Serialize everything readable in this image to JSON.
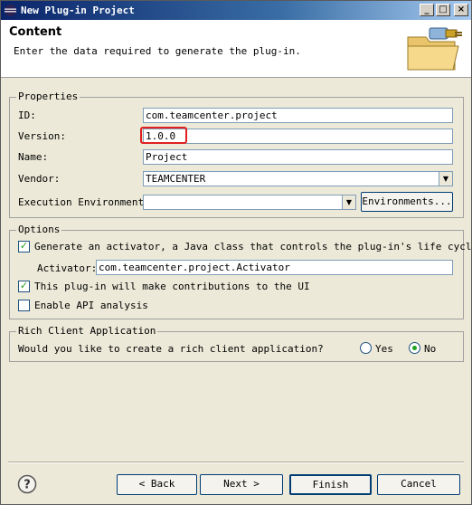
{
  "window": {
    "title": "New Plug-in Project",
    "minimize": "_",
    "maximize": "□",
    "close": "×"
  },
  "header": {
    "title": "Content",
    "description": "Enter the data required to generate the plug-in."
  },
  "properties": {
    "group_label": "Properties",
    "id_label": "ID:",
    "id_value": "com.teamcenter.project",
    "version_label": "Version:",
    "version_value": "1.0.0",
    "name_label": "Name:",
    "name_value": "Project",
    "vendor_label": "Vendor:",
    "vendor_value": "TEAMCENTER",
    "exec_env_label": "Execution Environment:",
    "exec_env_value": "",
    "environments_button": "Environments..."
  },
  "options": {
    "group_label": "Options",
    "generate_activator_label": "Generate an activator, a Java class that controls the plug-in's life cycle",
    "generate_activator_checked": true,
    "activator_label": "Activator:",
    "activator_value": "com.teamcenter.project.Activator",
    "ui_contrib_label": "This plug-in will make contributions to the UI",
    "ui_contrib_checked": true,
    "api_analysis_label": "Enable API analysis",
    "api_analysis_checked": false
  },
  "rca": {
    "group_label": "Rich Client Application",
    "question": "Would you like to create a rich client application?",
    "yes_label": "Yes",
    "no_label": "No",
    "selected": "No"
  },
  "footer": {
    "back": "< Back",
    "next": "Next >",
    "finish": "Finish",
    "cancel": "Cancel"
  },
  "colors": {
    "highlight": "#e02020",
    "title_bar": "#0a246a",
    "check": "#21a121"
  }
}
